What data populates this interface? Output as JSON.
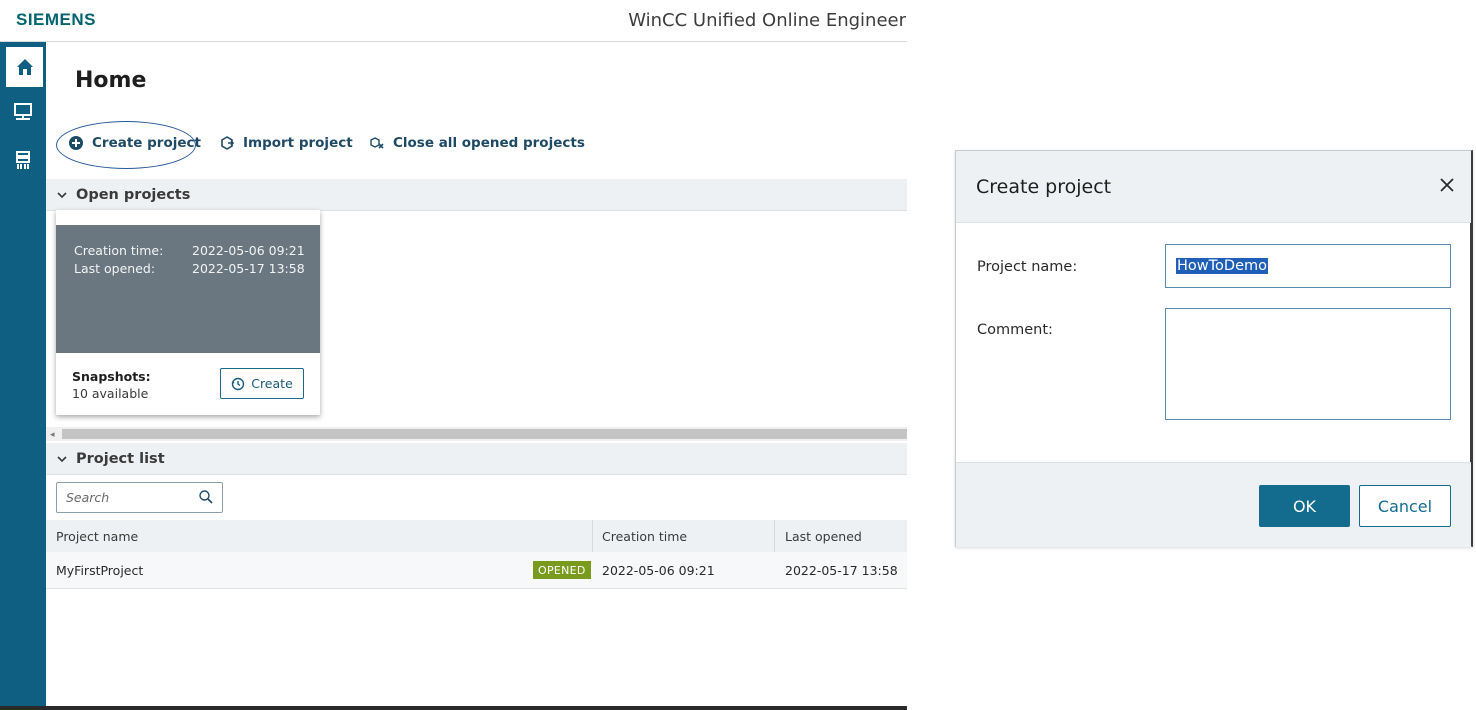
{
  "app": {
    "brand": "SIEMENS",
    "title": "WinCC Unified Online Engineeri"
  },
  "nav": {
    "items": [
      {
        "icon": "home-icon",
        "active": true
      },
      {
        "icon": "monitor-icon",
        "active": false
      },
      {
        "icon": "device-icon",
        "active": false
      }
    ]
  },
  "page": {
    "title": "Home"
  },
  "toolbar": {
    "create_label": "Create project",
    "import_label": "Import project",
    "close_all_label": "Close all opened projects"
  },
  "open_projects": {
    "header": "Open projects",
    "card": {
      "creation_time_label": "Creation time:",
      "creation_time_value": "2022-05-06 09:21",
      "last_opened_label": "Last opened:",
      "last_opened_value": "2022-05-17 13:58",
      "snapshots_label": "Snapshots:",
      "snapshots_count": "10 available",
      "create_button": "Create"
    }
  },
  "project_list": {
    "header": "Project list",
    "search_placeholder": "Search",
    "columns": [
      "Project name",
      "Creation time",
      "Last opened"
    ],
    "rows": [
      {
        "name": "MyFirstProject",
        "status": "OPENED",
        "creation_time": "2022-05-06 09:21",
        "last_opened": "2022-05-17 13:58"
      }
    ]
  },
  "dialog": {
    "title": "Create project",
    "project_name_label": "Project name:",
    "project_name_value": "HowToDemo",
    "comment_label": "Comment:",
    "ok_label": "OK",
    "cancel_label": "Cancel"
  },
  "colors": {
    "nav_bg": "#0f5f83",
    "brand": "#00646e",
    "primary_button": "#136c8e",
    "badge_opened": "#7a9a1e",
    "card_gray": "#6a7780"
  }
}
